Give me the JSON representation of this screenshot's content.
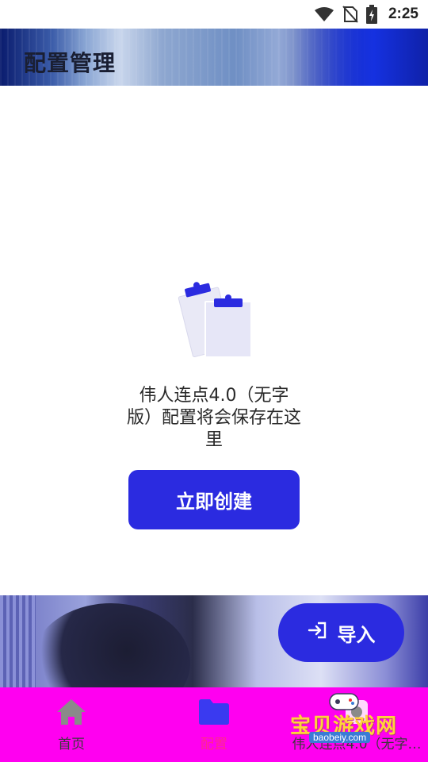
{
  "status_bar": {
    "time": "2:25",
    "icons": [
      "wifi-icon",
      "no-sim-icon",
      "battery-charging-icon"
    ]
  },
  "header": {
    "title": "配置管理"
  },
  "empty_state": {
    "illustration": "clipboard-icon",
    "message": "伟人连点4.0（无字版）配置将会保存在这里",
    "create_button_label": "立即创建"
  },
  "import_button": {
    "icon": "import-icon",
    "label": "导入"
  },
  "bottom_nav": {
    "items": [
      {
        "label": "首页",
        "icon": "home-icon",
        "active": false
      },
      {
        "label": "配置",
        "icon": "folder-icon",
        "active": true
      },
      {
        "label": "伟人连点4.0（无字…",
        "icon": "app-icon",
        "active": false
      }
    ]
  },
  "watermark": {
    "text": "宝贝游戏网",
    "url": "baobeiy.com"
  },
  "colors": {
    "accent": "#2b2be0",
    "nav_background": "#ff00f0",
    "nav_active_label": "#ff2a8a"
  }
}
